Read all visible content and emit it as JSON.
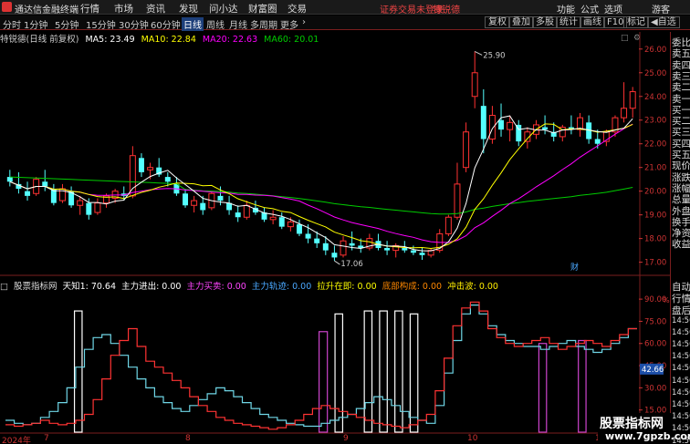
{
  "menubar": {
    "app_title": "通达信金融终端",
    "menus": [
      "行情",
      "市场",
      "资讯",
      "发现",
      "问小达",
      "财富圈",
      "交易"
    ],
    "login_notice": "证券交易未登录",
    "feature_label": "特锐德",
    "right_menus": [
      "功能",
      "公式",
      "选项"
    ],
    "guest": "游客"
  },
  "toolbar": {
    "periods": [
      "分时",
      "1分钟",
      "5分钟",
      "15分钟",
      "30分钟",
      "60分钟",
      "日线",
      "周线",
      "月线",
      "多周期",
      "更多"
    ],
    "active_period": "日线",
    "buttons": [
      "复权",
      "叠加",
      "多股",
      "统计",
      "画线",
      "F10",
      "标记",
      "◀自选"
    ]
  },
  "main_header": {
    "stock": "特锐德(日线 前复权)",
    "ma5": "MA5: 23.49",
    "ma10": "MA10: 22.84",
    "ma20": "MA20: 22.63",
    "ma60": "MA60: 20.01",
    "colors": {
      "ma5": "#ffffff",
      "ma10": "#ffff00",
      "ma20": "#ff00ff",
      "ma60": "#00cc00"
    }
  },
  "indicator_header": {
    "name": "股票指标网",
    "items": [
      {
        "text": "天知1: 70.64",
        "color": "#ffffff"
      },
      {
        "text": "主力进出: 0.00",
        "color": "#ffffff"
      },
      {
        "text": "主力买卖: 0.00",
        "color": "#ff44ff"
      },
      {
        "text": "主力轨迹: 0.00",
        "color": "#4aa8ff"
      },
      {
        "text": "拉升在即: 0.00",
        "color": "#ffff00"
      },
      {
        "text": "底部构成: 0.00",
        "color": "#ff8800"
      },
      {
        "text": "冲击波: 0.00",
        "color": "#ffee00"
      }
    ]
  },
  "price_axis": [
    "26.00",
    "25.00",
    "24.00",
    "23.00",
    "22.00",
    "21.00",
    "20.00",
    "19.00",
    "18.00",
    "17.00"
  ],
  "indicator_axis": [
    "90.00",
    "75.00",
    "60.00",
    "45.00",
    "30.00",
    "15.00",
    "0.00"
  ],
  "axis_unit": "%",
  "indicator_marker": "42.66",
  "annotations": {
    "high": "25.90",
    "low": "17.06",
    "cai": "财"
  },
  "dates": [
    "2024年",
    "7",
    "8",
    "9",
    "10",
    "11"
  ],
  "side_panel": [
    "委比",
    "卖五",
    "卖四",
    "卖三",
    "卖二",
    "卖一",
    "买一",
    "买二",
    "买三",
    "买四",
    "买五",
    "现价",
    "涨跌",
    "涨幅",
    "总量",
    "外盘",
    "换手",
    "净资",
    "收益",
    "自动",
    "行情",
    "盘后",
    "14:50",
    "14:50",
    "14:50",
    "14:50",
    "14:50",
    "14:50",
    "14:50",
    "14:50",
    "14:50",
    "14:50",
    "14:50"
  ],
  "watermark": {
    "line1": "股票指标网",
    "line2": "www.7gpzb.com"
  },
  "chart_data": [
    {
      "type": "candlestick",
      "title": "特锐德(日线 前复权)",
      "y_axis_ticks": [
        17,
        18,
        19,
        20,
        21,
        22,
        23,
        24,
        25,
        26
      ],
      "ylim": [
        16.6,
        26.3
      ],
      "candles": [
        [
          20.6,
          20.9,
          20.2,
          20.4
        ],
        [
          20.3,
          20.8,
          19.9,
          20.1
        ],
        [
          20.0,
          20.4,
          19.6,
          19.8
        ],
        [
          19.9,
          20.6,
          19.8,
          20.5
        ],
        [
          20.4,
          20.9,
          20.0,
          20.2
        ],
        [
          20.1,
          20.3,
          19.4,
          19.5
        ],
        [
          19.6,
          20.3,
          19.5,
          20.1
        ],
        [
          20.0,
          20.2,
          19.3,
          19.4
        ],
        [
          19.4,
          19.8,
          19.0,
          19.6
        ],
        [
          19.5,
          19.7,
          18.8,
          19.0
        ],
        [
          19.1,
          19.7,
          19.0,
          19.5
        ],
        [
          19.5,
          19.9,
          19.3,
          19.8
        ],
        [
          19.7,
          20.1,
          19.5,
          20.0
        ],
        [
          19.9,
          20.2,
          19.6,
          19.8
        ],
        [
          19.8,
          21.9,
          19.7,
          21.5
        ],
        [
          21.4,
          21.6,
          20.6,
          20.8
        ],
        [
          20.9,
          21.2,
          20.5,
          21.0
        ],
        [
          21.0,
          21.4,
          20.6,
          20.7
        ],
        [
          20.6,
          20.8,
          20.2,
          20.4
        ],
        [
          20.3,
          20.6,
          19.8,
          19.9
        ],
        [
          19.9,
          20.1,
          19.3,
          19.4
        ],
        [
          19.4,
          19.8,
          19.1,
          19.6
        ],
        [
          19.5,
          19.8,
          19.0,
          19.2
        ],
        [
          19.3,
          20.0,
          19.2,
          19.9
        ],
        [
          19.8,
          20.2,
          19.4,
          19.6
        ],
        [
          19.5,
          19.8,
          19.0,
          19.2
        ],
        [
          19.1,
          19.4,
          18.7,
          18.9
        ],
        [
          18.9,
          19.6,
          18.8,
          19.4
        ],
        [
          19.3,
          19.6,
          19.0,
          19.1
        ],
        [
          19.1,
          19.3,
          18.7,
          18.8
        ],
        [
          18.8,
          19.2,
          18.6,
          18.9
        ],
        [
          18.9,
          19.1,
          18.4,
          18.5
        ],
        [
          18.5,
          18.9,
          18.3,
          18.7
        ],
        [
          18.6,
          18.8,
          18.1,
          18.2
        ],
        [
          18.2,
          18.6,
          17.8,
          18.0
        ],
        [
          18.0,
          18.3,
          17.6,
          17.8
        ],
        [
          17.8,
          18.1,
          17.3,
          17.5
        ],
        [
          17.4,
          17.7,
          17.06,
          17.2
        ],
        [
          17.3,
          18.1,
          17.2,
          17.9
        ],
        [
          17.8,
          18.3,
          17.5,
          17.7
        ],
        [
          17.7,
          18.0,
          17.4,
          17.6
        ],
        [
          17.6,
          18.2,
          17.5,
          18.0
        ],
        [
          17.9,
          18.2,
          17.5,
          17.6
        ],
        [
          17.6,
          17.9,
          17.3,
          17.5
        ],
        [
          17.5,
          17.8,
          17.2,
          17.7
        ],
        [
          17.6,
          17.9,
          17.4,
          17.5
        ],
        [
          17.5,
          17.7,
          17.3,
          17.4
        ],
        [
          17.4,
          17.6,
          17.1,
          17.3
        ],
        [
          17.3,
          17.6,
          17.2,
          17.5
        ],
        [
          17.5,
          18.4,
          17.4,
          18.2
        ],
        [
          18.2,
          19.0,
          18.1,
          18.9
        ],
        [
          18.9,
          21.2,
          18.8,
          20.3
        ],
        [
          21.0,
          22.9,
          20.8,
          22.5
        ],
        [
          24.0,
          25.9,
          23.5,
          25.0
        ],
        [
          23.6,
          24.3,
          21.6,
          22.2
        ],
        [
          22.2,
          23.6,
          22.0,
          23.2
        ],
        [
          23.0,
          23.7,
          22.3,
          22.6
        ],
        [
          22.6,
          23.2,
          22.1,
          22.9
        ],
        [
          22.8,
          23.0,
          21.9,
          22.1
        ],
        [
          22.1,
          22.7,
          21.8,
          22.5
        ],
        [
          22.4,
          23.0,
          22.2,
          22.8
        ],
        [
          22.7,
          23.2,
          22.4,
          22.6
        ],
        [
          22.5,
          22.9,
          22.1,
          22.3
        ],
        [
          22.3,
          22.8,
          22.1,
          22.7
        ],
        [
          22.7,
          23.2,
          22.4,
          22.6
        ],
        [
          22.6,
          23.3,
          22.3,
          23.1
        ],
        [
          22.9,
          23.2,
          22.0,
          22.2
        ],
        [
          22.2,
          22.6,
          21.8,
          22.0
        ],
        [
          22.1,
          22.6,
          21.9,
          22.5
        ],
        [
          22.5,
          23.2,
          22.3,
          23.1
        ],
        [
          23.1,
          24.6,
          22.9,
          23.5
        ],
        [
          23.5,
          24.4,
          23.1,
          24.2
        ]
      ]
    },
    {
      "type": "step-line",
      "title": "股票指标网",
      "y_axis_ticks": [
        0,
        15,
        30,
        45,
        60,
        75,
        90
      ],
      "ylim": [
        0,
        95
      ],
      "series": [
        {
          "name": "天知1",
          "color": "#ffffff"
        },
        {
          "name": "主力进出",
          "color": "#ff3333"
        },
        {
          "name": "主力买卖",
          "color": "#ff44ff"
        },
        {
          "name": "主力轨迹",
          "color": "#4aa8ff"
        }
      ],
      "bars": [
        {
          "type": "white",
          "x": 0.114,
          "w": 0.012,
          "top": 82
        },
        {
          "type": "magenta",
          "x": 0.498,
          "w": 0.013,
          "top": 68
        },
        {
          "type": "white",
          "x": 0.523,
          "w": 0.012,
          "top": 80
        },
        {
          "type": "white",
          "x": 0.569,
          "w": 0.012,
          "top": 82
        },
        {
          "type": "white",
          "x": 0.593,
          "w": 0.012,
          "top": 82
        },
        {
          "type": "white",
          "x": 0.617,
          "w": 0.012,
          "top": 82
        },
        {
          "type": "white",
          "x": 0.641,
          "w": 0.012,
          "top": 80
        },
        {
          "type": "magenta",
          "x": 0.843,
          "w": 0.012,
          "top": 60
        },
        {
          "type": "magenta",
          "x": 0.905,
          "w": 0.012,
          "top": 62
        }
      ],
      "series_red": [
        5,
        4,
        5,
        6,
        8,
        6,
        5,
        6,
        8,
        12,
        22,
        36,
        52,
        62,
        70,
        58,
        48,
        44,
        40,
        35,
        30,
        24,
        18,
        14,
        10,
        8,
        6,
        5,
        4,
        3,
        2,
        3,
        5,
        8,
        12,
        16,
        18,
        16,
        14,
        12,
        10,
        8,
        6,
        5,
        4,
        3,
        5,
        8,
        12,
        28,
        50,
        72,
        84,
        88,
        82,
        70,
        64,
        60,
        58,
        60,
        62,
        64,
        60,
        56,
        58,
        60,
        62,
        60,
        58,
        62,
        66,
        70
      ],
      "series_cyan": [
        8,
        6,
        5,
        6,
        10,
        14,
        20,
        30,
        44,
        56,
        64,
        66,
        60,
        52,
        44,
        36,
        30,
        24,
        20,
        16,
        14,
        18,
        22,
        26,
        30,
        28,
        24,
        20,
        16,
        12,
        10,
        8,
        6,
        5,
        4,
        4,
        6,
        8,
        10,
        12,
        16,
        20,
        24,
        22,
        18,
        14,
        10,
        8,
        6,
        18,
        40,
        62,
        80,
        86,
        80,
        72,
        66,
        62,
        60,
        58,
        58,
        56,
        58,
        60,
        62,
        58,
        56,
        54,
        56,
        60,
        64,
        70
      ]
    }
  ]
}
